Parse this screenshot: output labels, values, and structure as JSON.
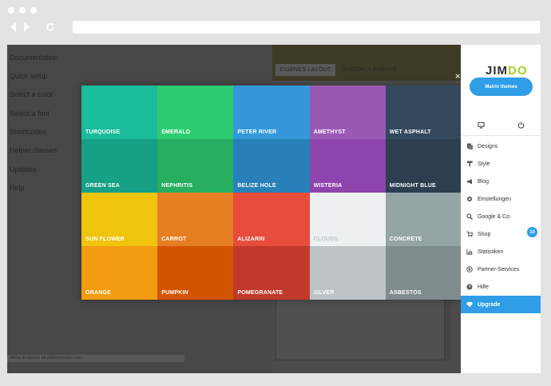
{
  "left_menu": {
    "items": [
      "Documentation",
      "Quick setup",
      "Select a color",
      "Select a font",
      "Shortcodes",
      "Helper classes",
      "Updates",
      "Help"
    ],
    "status_text": "Attesa di risposta da platform.twitter.com..."
  },
  "tabs": [
    "EIGENES LAYOUT",
    "SPEZIAL-LAYOUTS"
  ],
  "close_symbol": "×",
  "colors": [
    {
      "name": "TURQUOISE",
      "hex": "#1abc9c"
    },
    {
      "name": "EMERALD",
      "hex": "#2ecc71"
    },
    {
      "name": "PETER RIVER",
      "hex": "#3498db"
    },
    {
      "name": "AMETHYST",
      "hex": "#9b59b6"
    },
    {
      "name": "WET ASPHALT",
      "hex": "#34495e"
    },
    {
      "name": "GREEN SEA",
      "hex": "#16a085"
    },
    {
      "name": "NEPHRITIS",
      "hex": "#27ae60"
    },
    {
      "name": "BELIZE HOLE",
      "hex": "#2980b9"
    },
    {
      "name": "WISTERIA",
      "hex": "#8e44ad"
    },
    {
      "name": "MIDNIGHT BLUE",
      "hex": "#2c3e50"
    },
    {
      "name": "SUN FLOWER",
      "hex": "#f1c40f"
    },
    {
      "name": "CARROT",
      "hex": "#e67e22"
    },
    {
      "name": "ALIZARIN",
      "hex": "#e74c3c"
    },
    {
      "name": "CLOUDS",
      "hex": "#ecf0f1"
    },
    {
      "name": "CONCRETE",
      "hex": "#95a5a6"
    },
    {
      "name": "ORANGE",
      "hex": "#f39c12"
    },
    {
      "name": "PUMPKIN",
      "hex": "#d35400"
    },
    {
      "name": "POMEGRANATE",
      "hex": "#c0392b"
    },
    {
      "name": "SILVER",
      "hex": "#bdc3c7"
    },
    {
      "name": "ASBESTOS",
      "hex": "#7f8c8d"
    }
  ],
  "sidebar": {
    "logo": {
      "jim": "JIM",
      "do": "DO",
      "do_color": "#a5d12a"
    },
    "cta": "Matrix themes",
    "top_icons": [
      "monitor-icon",
      "power-icon"
    ],
    "items": [
      {
        "label": "Designs",
        "icon": "layers-icon"
      },
      {
        "label": "Style",
        "icon": "brush-icon"
      },
      {
        "label": "Blog",
        "icon": "megaphone-icon"
      },
      {
        "label": "Einstellungen",
        "icon": "gear-icon"
      },
      {
        "label": "Google & Co.",
        "icon": "search-icon"
      },
      {
        "label": "Shop",
        "icon": "cart-icon"
      },
      {
        "label": "Statistiken",
        "icon": "chart-icon"
      },
      {
        "label": "Partner-Services",
        "icon": "plus-circle-icon"
      },
      {
        "label": "Hilfe",
        "icon": "help-icon"
      },
      {
        "label": "Upgrade",
        "icon": "heart-icon"
      }
    ],
    "shop_badge": "10",
    "accent": "#2f9ee6"
  }
}
